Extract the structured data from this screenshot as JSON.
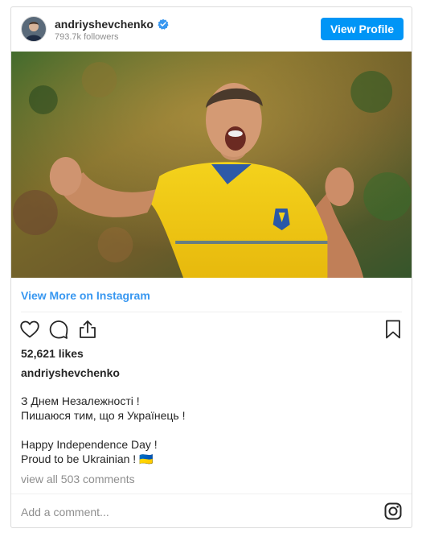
{
  "header": {
    "username": "andriyshevchenko",
    "followers": "793.7k followers",
    "view_profile_label": "View Profile"
  },
  "post": {
    "view_more_label": "View More on Instagram",
    "likes": "52,621 likes",
    "caption_user": "andriyshevchenko",
    "caption_lines": [
      "З Днем Незалежності !",
      "Пишаюся тим, що я Українець !",
      "Happy Independence Day !",
      "Proud to be Ukrainian ! 🇺🇦"
    ],
    "comments_link": "view all 503 comments",
    "add_comment_placeholder": "Add a comment..."
  },
  "icons": {
    "verified": "verified-badge-icon",
    "like": "heart-icon",
    "comment": "comment-icon",
    "share": "share-icon",
    "save": "bookmark-icon",
    "instagram": "instagram-logo-icon"
  },
  "colors": {
    "accent": "#0095f6",
    "link": "#3897f0",
    "muted": "#8e8e8e",
    "border": "#dbdbdb"
  }
}
